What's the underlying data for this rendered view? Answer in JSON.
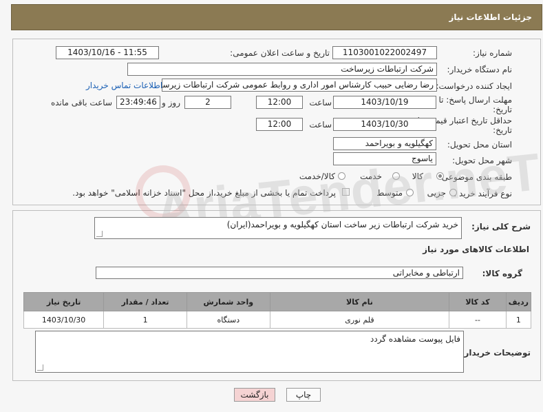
{
  "header": {
    "title": "جزئیات اطلاعات نیاز"
  },
  "fields": {
    "need_number_label": "شماره نیاز:",
    "need_number": "1103001022002497",
    "announce_label": "تاریخ و ساعت اعلان عمومی:",
    "announce_value": "1403/10/16 - 11:55",
    "buyer_org_label": "نام دستگاه خریدار:",
    "buyer_org": "شرکت ارتباطات زیرساخت",
    "creator_label": "ایجاد کننده درخواست:",
    "creator": "رضا رضایی حبیب کارشناس امور اداری و روابط عمومی شرکت ارتباطات زیرساخت",
    "contact_link": "اطلاعات تماس خریدار",
    "deadline_label_1": "مهلت ارسال پاسخ: تا",
    "deadline_label_2": "تاریخ:",
    "deadline_date": "1403/10/19",
    "time_label": "ساعت",
    "deadline_time": "12:00",
    "days_value": "2",
    "days_label": "روز و",
    "remaining_time": "23:49:46",
    "remaining_label": "ساعت باقی مانده",
    "validity_label_1": "حداقل تاریخ اعتبار قیمت: تا",
    "validity_label_2": "تاریخ:",
    "validity_date": "1403/10/30",
    "validity_time_label": "ساعت",
    "validity_time": "12:00",
    "province_label": "استان محل تحویل:",
    "province": "کهگیلویه و بویراحمد",
    "city_label": "شهر محل تحویل:",
    "city": "یاسوج",
    "category_label": "طبقه بندی موضوعی:",
    "category_options": [
      "کالا",
      "خدمت",
      "کالا/خدمت"
    ],
    "category_selected": "کالا",
    "purchase_type_label": "نوع فرآیند خرید :",
    "purchase_options": [
      "جزیی",
      "متوسط"
    ],
    "payment_note": "پرداخت تمام یا بخشی از مبلغ خرید،از محل \"اسناد خزانه اسلامی\" خواهد بود."
  },
  "description": {
    "label": "شرح کلی نیاز:",
    "value": "خرید شرکت ارتباطات زیر ساخت استان کهگیلویه و بویراحمد(ایران)"
  },
  "goods": {
    "section_title": "اطلاعات کالاهای مورد نیاز",
    "group_label": "گروه کالا:",
    "group_value": "ارتباطی و مخابراتی",
    "columns": [
      "ردیف",
      "کد کالا",
      "نام کالا",
      "واحد شمارش",
      "تعداد / مقدار",
      "تاریخ نیاز"
    ],
    "rows": [
      {
        "row": "1",
        "code": "--",
        "name": "قلم نوری",
        "unit": "دستگاه",
        "qty": "1",
        "date": "1403/10/30"
      }
    ]
  },
  "buyer_notes": {
    "label": "توضیحات خریدار:",
    "value": "فایل پیوست مشاهده گردد"
  },
  "buttons": {
    "print": "چاپ",
    "back": "بازگشت"
  },
  "watermark": "AriaTender.neT",
  "colors": {
    "header_bg": "#8b7a53",
    "table_header_bg": "#a8a8a8",
    "back_button_bg": "#f5d3d3",
    "link": "#1a5fb4"
  }
}
